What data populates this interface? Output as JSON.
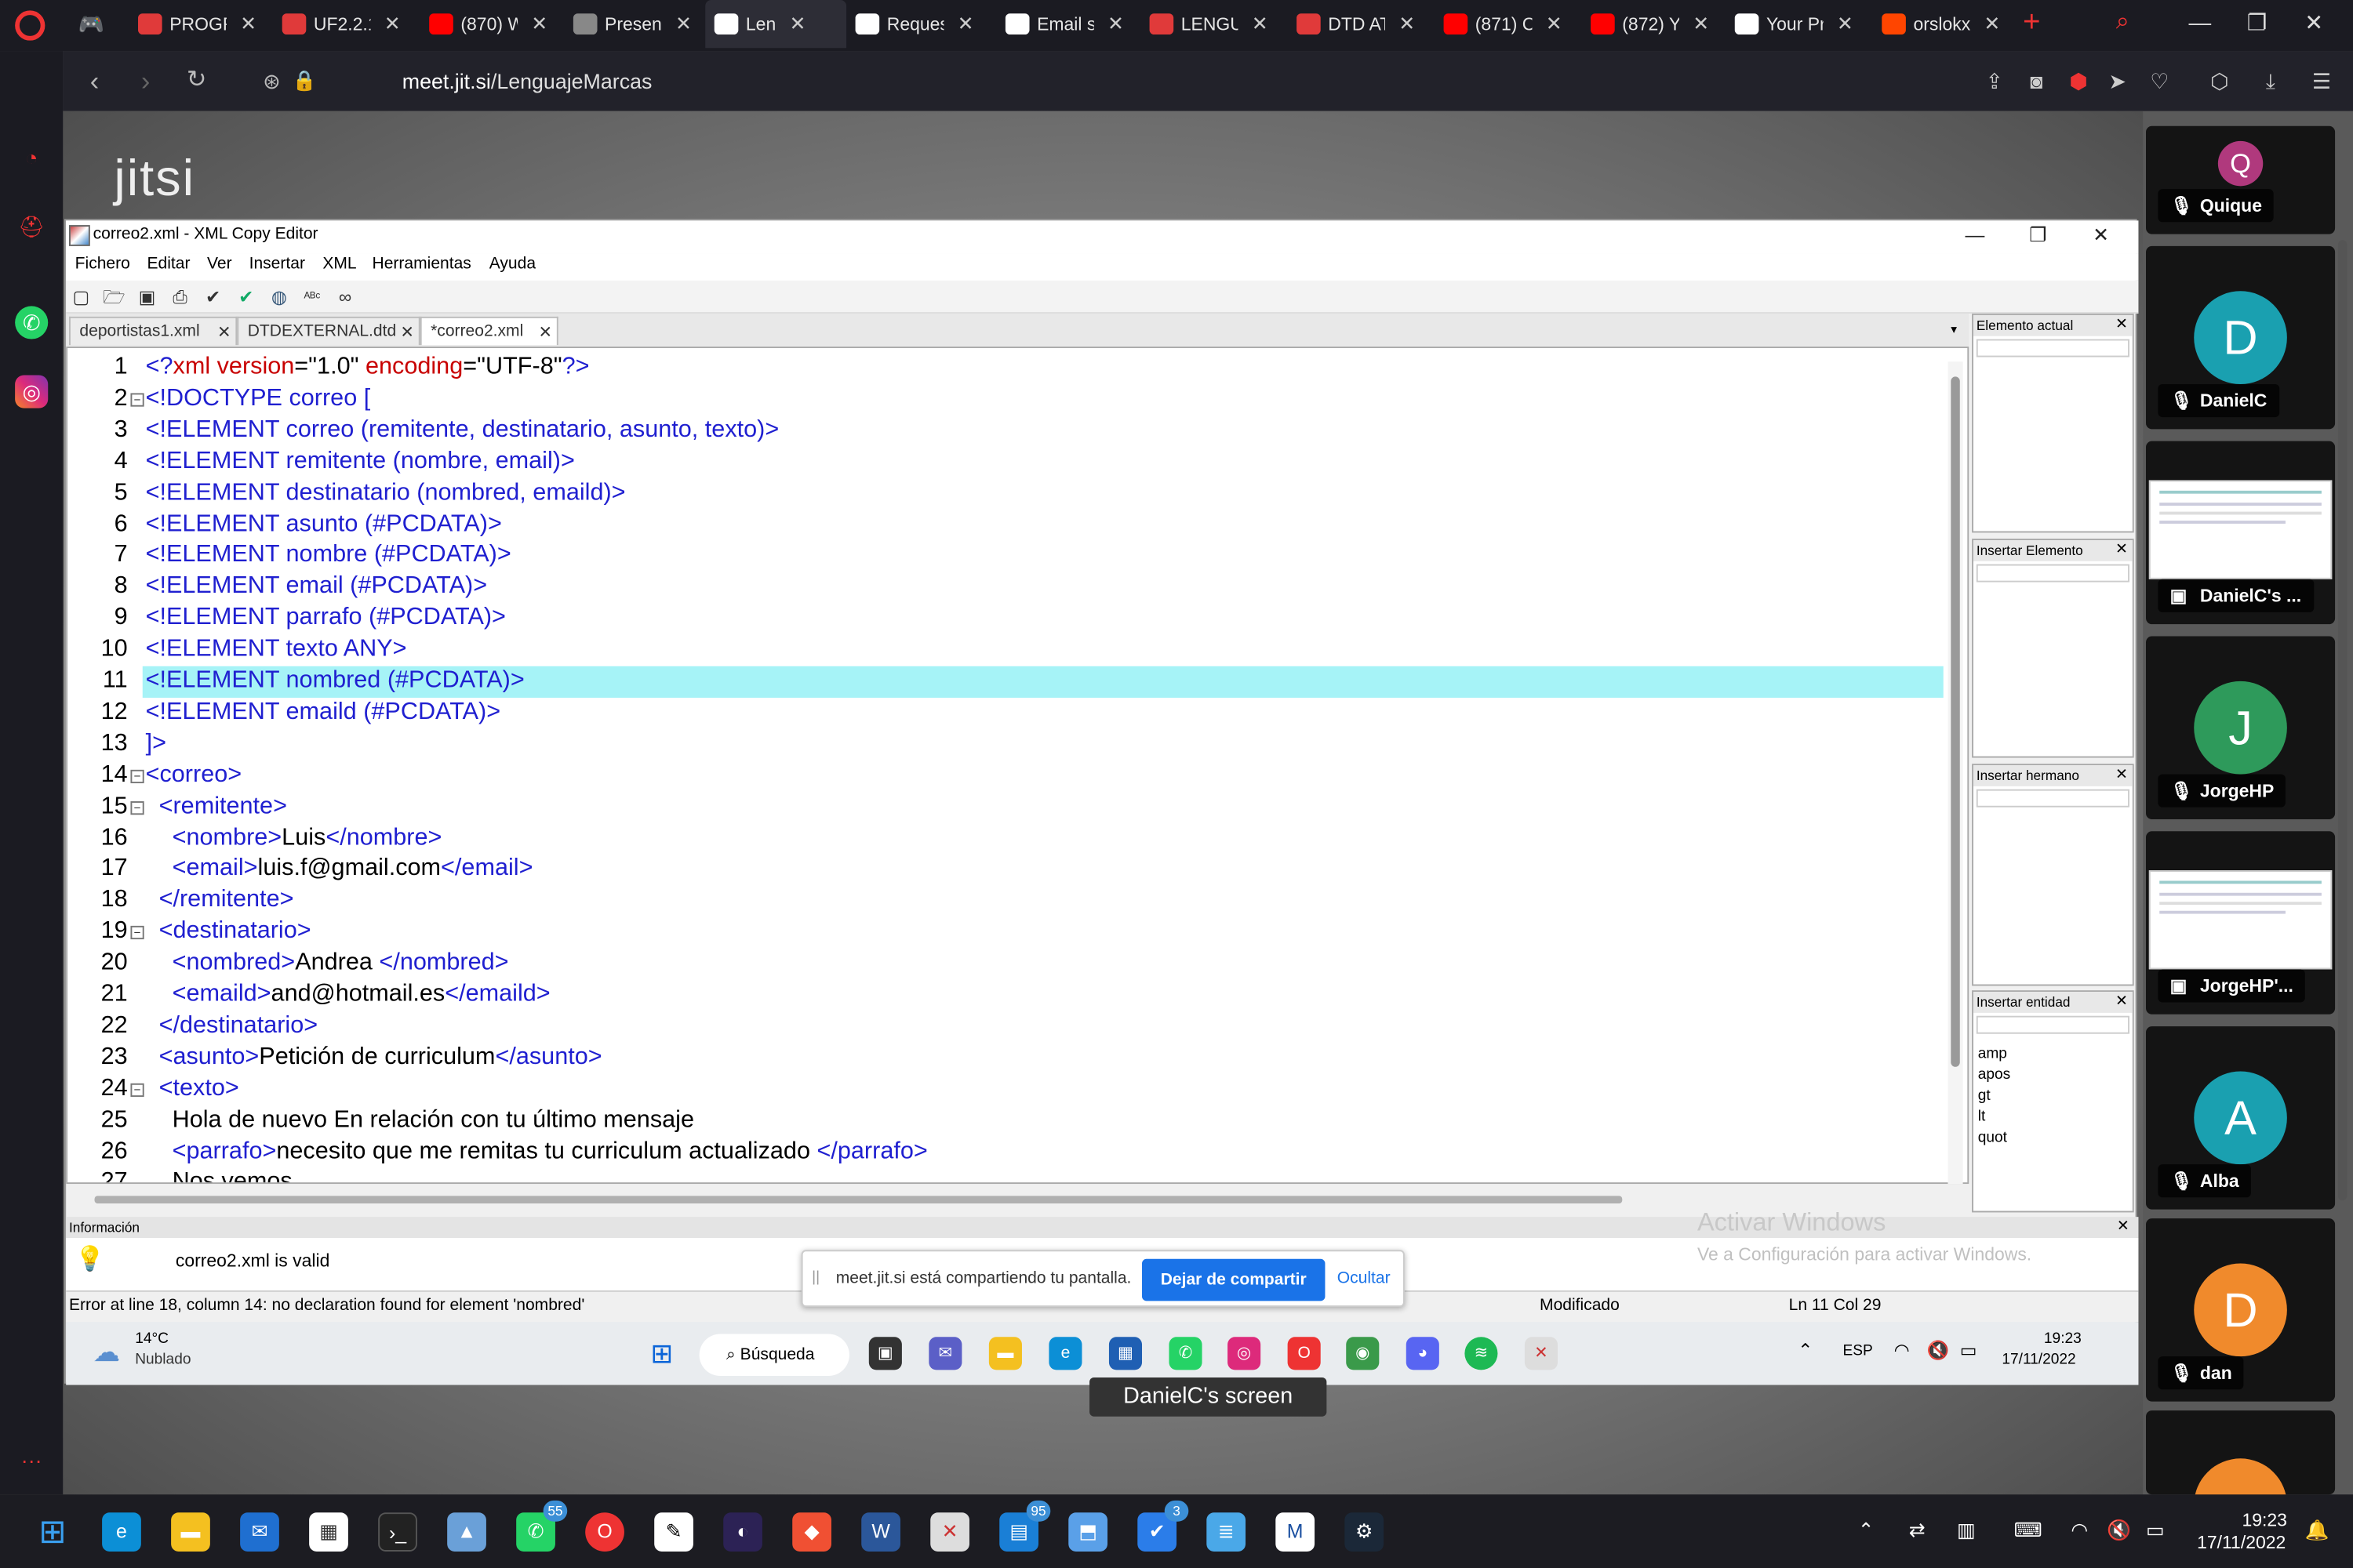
{
  "browser": {
    "tabs": [
      {
        "label": "PROGR",
        "icon": "ue-icon",
        "color": "#e03a3a"
      },
      {
        "label": "UF2.2.1",
        "icon": "ue-icon",
        "color": "#e03a3a"
      },
      {
        "label": "(870) W",
        "icon": "youtube-icon",
        "color": "#ff0000"
      },
      {
        "label": "Present",
        "icon": "chrome-web-icon",
        "color": "#888888"
      },
      {
        "label": "Len",
        "icon": "jitsi-icon",
        "color": "#ffffff"
      },
      {
        "label": "Reques",
        "icon": "github-icon",
        "color": "#ffffff"
      },
      {
        "label": "Email s",
        "icon": "github-icon",
        "color": "#ffffff"
      },
      {
        "label": "LENGU",
        "icon": "ue-icon",
        "color": "#e03a3a"
      },
      {
        "label": "DTD AT",
        "icon": "ue-icon",
        "color": "#e03a3a"
      },
      {
        "label": "(871) C",
        "icon": "youtube-icon",
        "color": "#ff0000"
      },
      {
        "label": "(872) Y",
        "icon": "youtube-icon",
        "color": "#ff0000"
      },
      {
        "label": "Your Pr",
        "icon": "github-icon",
        "color": "#ffffff"
      },
      {
        "label": "orslokx",
        "icon": "reddit-icon",
        "color": "#ff4500"
      }
    ],
    "url_domain": "meet.jit.si",
    "url_path": "/LenguajeMarcas"
  },
  "jitsi": {
    "logo": "jitsi",
    "screen_label": "DanielC's screen",
    "participants": [
      {
        "name": "Quique",
        "initial": "Q",
        "color": "#b0397d",
        "type": "avatar"
      },
      {
        "name": "DanielC",
        "initial": "D",
        "color": "#1aa0b0",
        "type": "avatar"
      },
      {
        "name": "DanielC's ...",
        "type": "screen"
      },
      {
        "name": "JorgeHP",
        "initial": "J",
        "color": "#2e9a5b",
        "type": "avatar"
      },
      {
        "name": "JorgeHP'...",
        "type": "screen"
      },
      {
        "name": "Alba",
        "initial": "A",
        "color": "#1aa0b0",
        "type": "avatar"
      },
      {
        "name": "dan",
        "initial": "D",
        "color": "#f08a2c",
        "type": "avatar"
      }
    ]
  },
  "editor": {
    "window_title": "correo2.xml - XML Copy Editor",
    "menu": [
      "Fichero",
      "Editar",
      "Ver",
      "Insertar",
      "XML",
      "Herramientas",
      "Ayuda"
    ],
    "tabs": [
      "deportistas1.xml",
      "DTDEXTERNAL.dtd",
      "*correo2.xml"
    ],
    "lines": [
      {
        "n": "1",
        "parts": [
          [
            "blue",
            "<?"
          ],
          [
            "red",
            "xml version"
          ],
          [
            "blk",
            "=\"1.0\" "
          ],
          [
            "red",
            "encoding"
          ],
          [
            "blk",
            "=\"UTF-8\""
          ],
          [
            "blue",
            "?>"
          ]
        ]
      },
      {
        "n": "2",
        "parts": [
          [
            "blue",
            "<!DOCTYPE correo ["
          ]
        ],
        "fold": "minus"
      },
      {
        "n": "3",
        "parts": [
          [
            "blue",
            "<!ELEMENT correo (remitente, destinatario, asunto, texto)>"
          ]
        ]
      },
      {
        "n": "4",
        "parts": [
          [
            "blue",
            "<!ELEMENT remitente (nombre, email)>"
          ]
        ]
      },
      {
        "n": "5",
        "parts": [
          [
            "blue",
            "<!ELEMENT destinatario (nombred, emaild)>"
          ]
        ]
      },
      {
        "n": "6",
        "parts": [
          [
            "blue",
            "<!ELEMENT asunto (#PCDATA)>"
          ]
        ]
      },
      {
        "n": "7",
        "parts": [
          [
            "blue",
            "<!ELEMENT nombre (#PCDATA)>"
          ]
        ]
      },
      {
        "n": "8",
        "parts": [
          [
            "blue",
            "<!ELEMENT email (#PCDATA)>"
          ]
        ]
      },
      {
        "n": "9",
        "parts": [
          [
            "blue",
            "<!ELEMENT parrafo (#PCDATA)>"
          ]
        ]
      },
      {
        "n": "10",
        "parts": [
          [
            "blue",
            "<!ELEMENT texto ANY>"
          ]
        ]
      },
      {
        "n": "11",
        "parts": [
          [
            "blue",
            "<!ELEMENT nombred (#PCDATA)>"
          ]
        ],
        "highlight": true
      },
      {
        "n": "12",
        "parts": [
          [
            "blue",
            "<!ELEMENT emaild (#PCDATA)>"
          ]
        ]
      },
      {
        "n": "13",
        "parts": [
          [
            "blue",
            "]>"
          ]
        ]
      },
      {
        "n": "14",
        "parts": [
          [
            "blue",
            "<correo>"
          ]
        ],
        "fold": "minus"
      },
      {
        "n": "15",
        "parts": [
          [
            "blue",
            "  <remitente>"
          ]
        ],
        "fold": "minus"
      },
      {
        "n": "16",
        "parts": [
          [
            "blue",
            "    <nombre>"
          ],
          [
            "blk",
            "Luis"
          ],
          [
            "blue",
            "</nombre>"
          ]
        ]
      },
      {
        "n": "17",
        "parts": [
          [
            "blue",
            "    <email>"
          ],
          [
            "blk",
            "luis.f@gmail.com"
          ],
          [
            "blue",
            "</email>"
          ]
        ]
      },
      {
        "n": "18",
        "parts": [
          [
            "blue",
            "  </remitente>"
          ]
        ]
      },
      {
        "n": "19",
        "parts": [
          [
            "blue",
            "  <destinatario>"
          ]
        ],
        "fold": "minus"
      },
      {
        "n": "20",
        "parts": [
          [
            "blue",
            "    <nombred>"
          ],
          [
            "blk",
            "Andrea "
          ],
          [
            "blue",
            "</nombred>"
          ]
        ]
      },
      {
        "n": "21",
        "parts": [
          [
            "blue",
            "    <emaild>"
          ],
          [
            "blk",
            "and@hotmail.es"
          ],
          [
            "blue",
            "</emaild>"
          ]
        ]
      },
      {
        "n": "22",
        "parts": [
          [
            "blue",
            "  </destinatario>"
          ]
        ]
      },
      {
        "n": "23",
        "parts": [
          [
            "blue",
            "  <asunto>"
          ],
          [
            "blk",
            "Petición de curriculum"
          ],
          [
            "blue",
            "</asunto>"
          ]
        ]
      },
      {
        "n": "24",
        "parts": [
          [
            "blue",
            "  <texto>"
          ]
        ],
        "fold": "minus"
      },
      {
        "n": "25",
        "parts": [
          [
            "blk",
            "    Hola de nuevo En relación con tu último mensaje"
          ]
        ]
      },
      {
        "n": "26",
        "parts": [
          [
            "blue",
            "    <parrafo>"
          ],
          [
            "blk",
            "necesito que me remitas tu curriculum actualizado "
          ],
          [
            "blue",
            "</parrafo>"
          ]
        ]
      },
      {
        "n": "27",
        "parts": [
          [
            "blk",
            "    Nos vemos"
          ]
        ]
      }
    ],
    "panels": {
      "current": "Elemento actual",
      "insert_element": "Insertar Elemento",
      "insert_sibling": "Insertar hermano",
      "insert_entity": "Insertar entidad",
      "entities": [
        "amp",
        "apos",
        "gt",
        "lt",
        "quot"
      ]
    },
    "info_label": "Información",
    "valid_message": "correo2.xml is valid",
    "status_error": "Error at line 18, column 14: no declaration found for element 'nombred'",
    "status_modified": "Modificado",
    "status_position": "Ln 11 Col 29",
    "activate_windows_title": "Activar Windows",
    "activate_windows_sub": "Ve a Configuración para activar Windows."
  },
  "sharebar": {
    "text": "meet.jit.si está compartiendo tu pantalla.",
    "stop_button": "Dejar de compartir",
    "hide_button": "Ocultar"
  },
  "inner_taskbar": {
    "temp": "14°C",
    "weather": "Nublado",
    "search": "Búsqueda",
    "lang": "ESP",
    "time": "19:23",
    "date": "17/11/2022"
  },
  "os_taskbar": {
    "time": "19:23",
    "date": "17/11/2022",
    "whatsapp_badge": "55",
    "teams_badge": "95",
    "todo_badge": "3"
  }
}
